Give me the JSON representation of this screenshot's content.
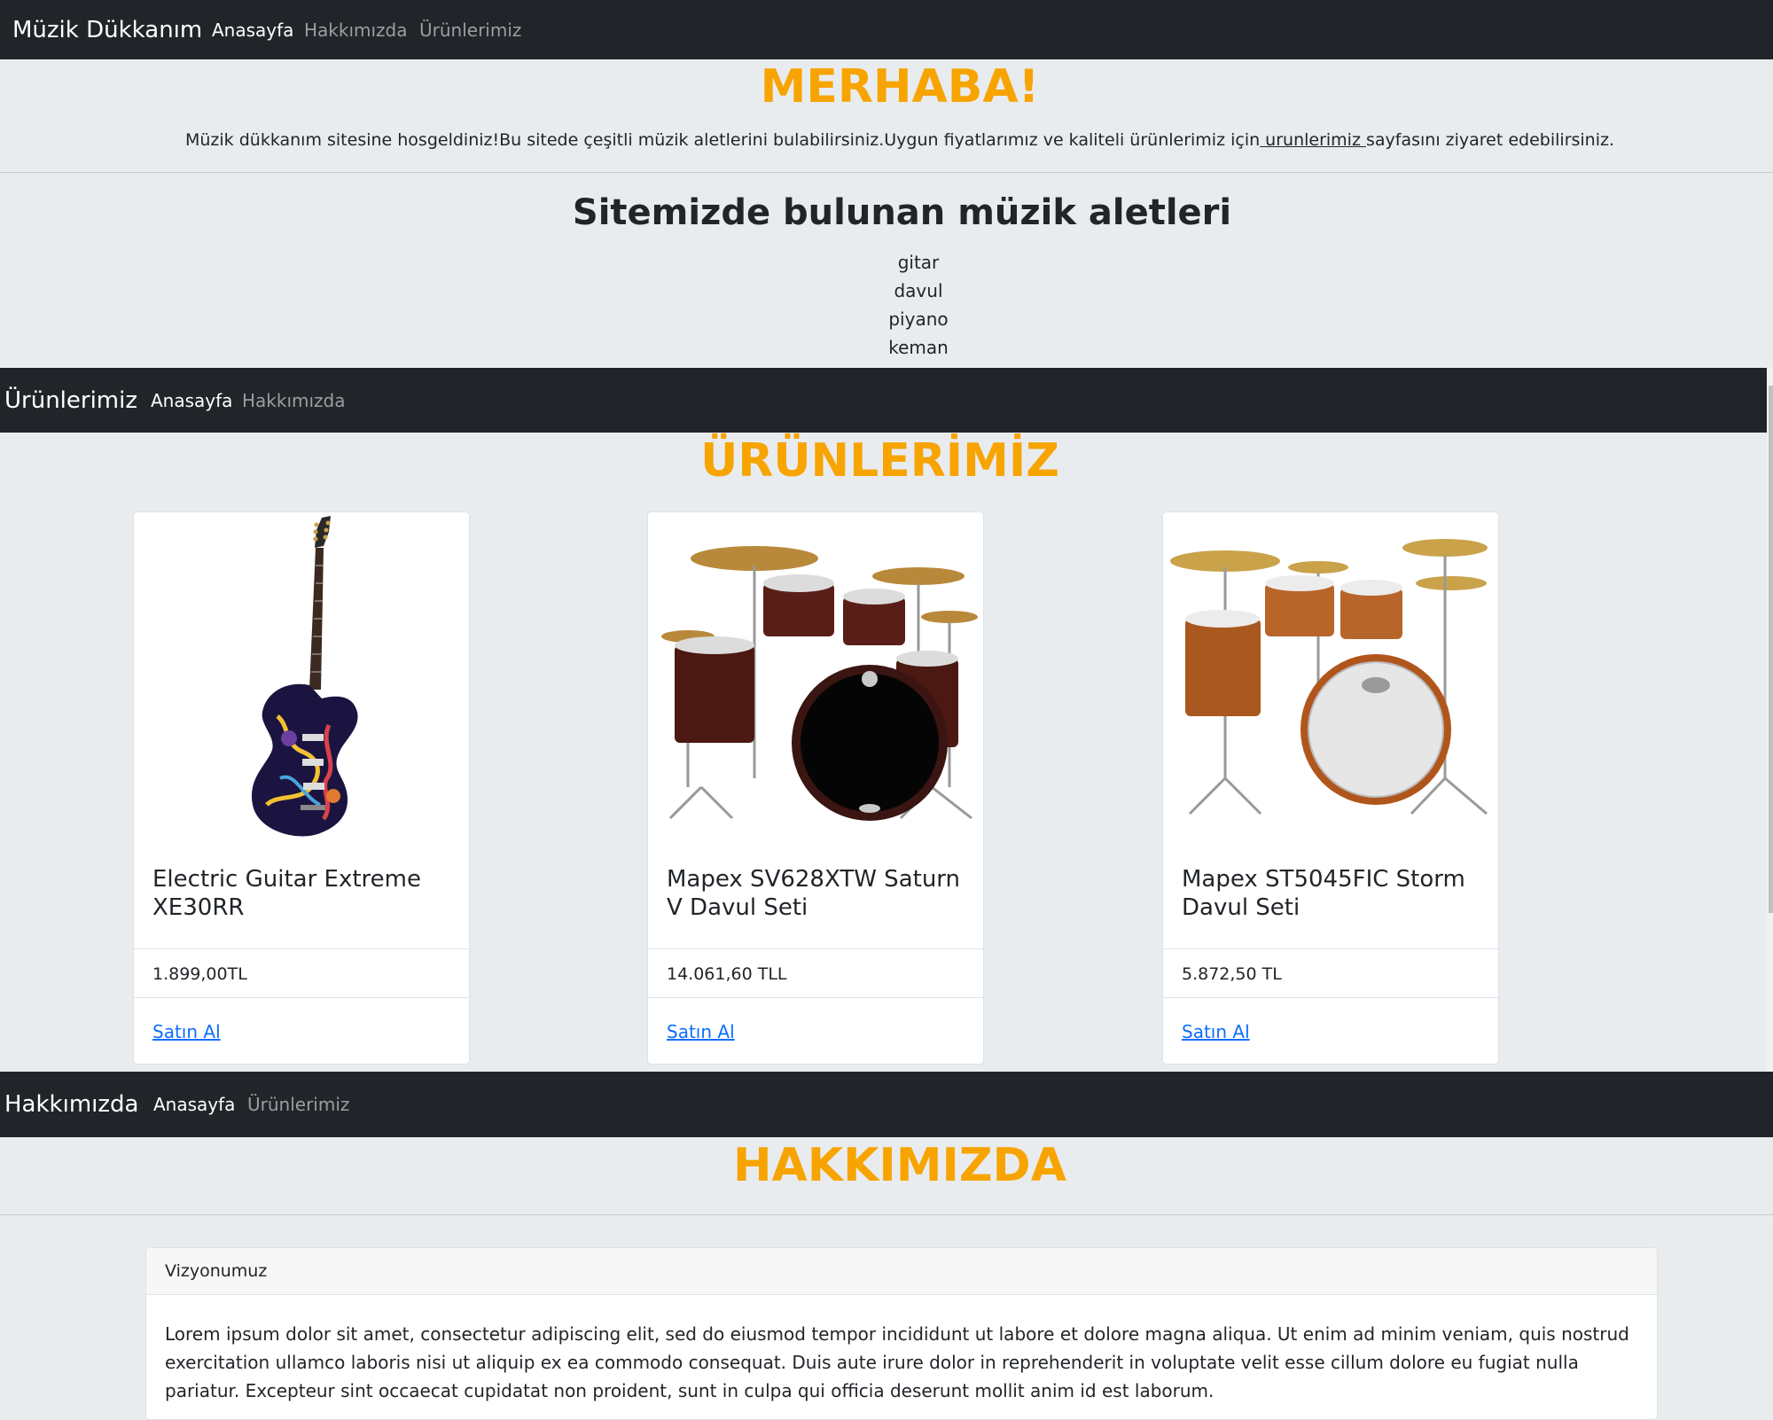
{
  "nav_home": {
    "brand": "Müzik Dükkanım",
    "links": [
      "Anasayfa",
      "Hakkımızda",
      "Ürünlerimiz"
    ]
  },
  "hero": {
    "title": "MERHABA!",
    "welcome_before": "Müzik dükkanım sitesine hosgeldiniz!Bu sitede çeşitli müzik aletlerini bulabilirsiniz.Uygun fiyatlarımız ve kaliteli ürünlerimiz için",
    "welcome_link": " urunlerimiz ",
    "welcome_after": "sayfasını ziyaret edebilirsiniz."
  },
  "instruments": {
    "heading": "Sitemizde bulunan müzik aletleri",
    "items": [
      "gitar",
      "davul",
      "piyano",
      "keman"
    ]
  },
  "nav_products": {
    "brand": "Ürünlerimiz",
    "links": [
      "Anasayfa",
      "Hakkımızda"
    ]
  },
  "products": {
    "title": "ÜRÜNLERİMİZ",
    "cards": [
      {
        "name": "Electric Guitar Extreme XE30RR",
        "price": "1.899,00TL",
        "buy": "Satın Al",
        "image": "guitar-image"
      },
      {
        "name": "Mapex SV628XTW Saturn V Davul Seti",
        "price": "14.061,60 TLL",
        "buy": "Satın Al",
        "image": "drum-kit-dark-image"
      },
      {
        "name": "Mapex ST5045FIC Storm Davul Seti",
        "price": "5.872,50 TL",
        "buy": "Satın Al",
        "image": "drum-kit-orange-image"
      }
    ]
  },
  "nav_about": {
    "brand": "Hakkımızda",
    "links": [
      "Anasayfa",
      "Ürünlerimiz"
    ]
  },
  "about": {
    "title": "HAKKIMIZDA",
    "vision_header": "Vizyonumuz",
    "vision_text": "Lorem ipsum dolor sit amet, consectetur adipiscing elit, sed do eiusmod tempor incididunt ut labore et dolore magna aliqua. Ut enim ad minim veniam, quis nostrud exercitation ullamco laboris nisi ut aliquip ex ea commodo consequat. Duis aute irure dolor in reprehenderit in voluptate velit esse cillum dolore eu fugiat nulla pariatur. Excepteur sint occaecat cupidatat non proident, sunt in culpa qui officia deserunt mollit anim id est laborum."
  },
  "colors": {
    "navbar": "#212529",
    "accent": "#f7a400",
    "link": "#0d6efd",
    "background": "#e9ecef"
  }
}
